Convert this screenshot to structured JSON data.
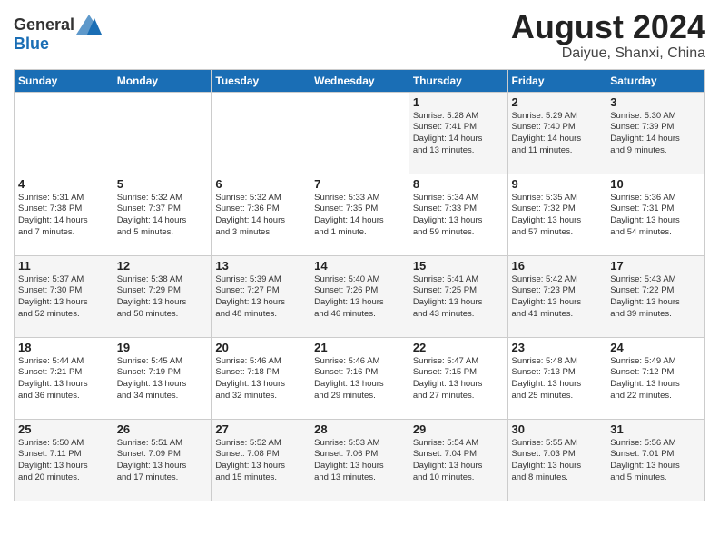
{
  "header": {
    "logo_general": "General",
    "logo_blue": "Blue",
    "month_year": "August 2024",
    "location": "Daiyue, Shanxi, China"
  },
  "weekdays": [
    "Sunday",
    "Monday",
    "Tuesday",
    "Wednesday",
    "Thursday",
    "Friday",
    "Saturday"
  ],
  "weeks": [
    [
      {
        "day": "",
        "info": ""
      },
      {
        "day": "",
        "info": ""
      },
      {
        "day": "",
        "info": ""
      },
      {
        "day": "",
        "info": ""
      },
      {
        "day": "1",
        "info": "Sunrise: 5:28 AM\nSunset: 7:41 PM\nDaylight: 14 hours\nand 13 minutes."
      },
      {
        "day": "2",
        "info": "Sunrise: 5:29 AM\nSunset: 7:40 PM\nDaylight: 14 hours\nand 11 minutes."
      },
      {
        "day": "3",
        "info": "Sunrise: 5:30 AM\nSunset: 7:39 PM\nDaylight: 14 hours\nand 9 minutes."
      }
    ],
    [
      {
        "day": "4",
        "info": "Sunrise: 5:31 AM\nSunset: 7:38 PM\nDaylight: 14 hours\nand 7 minutes."
      },
      {
        "day": "5",
        "info": "Sunrise: 5:32 AM\nSunset: 7:37 PM\nDaylight: 14 hours\nand 5 minutes."
      },
      {
        "day": "6",
        "info": "Sunrise: 5:32 AM\nSunset: 7:36 PM\nDaylight: 14 hours\nand 3 minutes."
      },
      {
        "day": "7",
        "info": "Sunrise: 5:33 AM\nSunset: 7:35 PM\nDaylight: 14 hours\nand 1 minute."
      },
      {
        "day": "8",
        "info": "Sunrise: 5:34 AM\nSunset: 7:33 PM\nDaylight: 13 hours\nand 59 minutes."
      },
      {
        "day": "9",
        "info": "Sunrise: 5:35 AM\nSunset: 7:32 PM\nDaylight: 13 hours\nand 57 minutes."
      },
      {
        "day": "10",
        "info": "Sunrise: 5:36 AM\nSunset: 7:31 PM\nDaylight: 13 hours\nand 54 minutes."
      }
    ],
    [
      {
        "day": "11",
        "info": "Sunrise: 5:37 AM\nSunset: 7:30 PM\nDaylight: 13 hours\nand 52 minutes."
      },
      {
        "day": "12",
        "info": "Sunrise: 5:38 AM\nSunset: 7:29 PM\nDaylight: 13 hours\nand 50 minutes."
      },
      {
        "day": "13",
        "info": "Sunrise: 5:39 AM\nSunset: 7:27 PM\nDaylight: 13 hours\nand 48 minutes."
      },
      {
        "day": "14",
        "info": "Sunrise: 5:40 AM\nSunset: 7:26 PM\nDaylight: 13 hours\nand 46 minutes."
      },
      {
        "day": "15",
        "info": "Sunrise: 5:41 AM\nSunset: 7:25 PM\nDaylight: 13 hours\nand 43 minutes."
      },
      {
        "day": "16",
        "info": "Sunrise: 5:42 AM\nSunset: 7:23 PM\nDaylight: 13 hours\nand 41 minutes."
      },
      {
        "day": "17",
        "info": "Sunrise: 5:43 AM\nSunset: 7:22 PM\nDaylight: 13 hours\nand 39 minutes."
      }
    ],
    [
      {
        "day": "18",
        "info": "Sunrise: 5:44 AM\nSunset: 7:21 PM\nDaylight: 13 hours\nand 36 minutes."
      },
      {
        "day": "19",
        "info": "Sunrise: 5:45 AM\nSunset: 7:19 PM\nDaylight: 13 hours\nand 34 minutes."
      },
      {
        "day": "20",
        "info": "Sunrise: 5:46 AM\nSunset: 7:18 PM\nDaylight: 13 hours\nand 32 minutes."
      },
      {
        "day": "21",
        "info": "Sunrise: 5:46 AM\nSunset: 7:16 PM\nDaylight: 13 hours\nand 29 minutes."
      },
      {
        "day": "22",
        "info": "Sunrise: 5:47 AM\nSunset: 7:15 PM\nDaylight: 13 hours\nand 27 minutes."
      },
      {
        "day": "23",
        "info": "Sunrise: 5:48 AM\nSunset: 7:13 PM\nDaylight: 13 hours\nand 25 minutes."
      },
      {
        "day": "24",
        "info": "Sunrise: 5:49 AM\nSunset: 7:12 PM\nDaylight: 13 hours\nand 22 minutes."
      }
    ],
    [
      {
        "day": "25",
        "info": "Sunrise: 5:50 AM\nSunset: 7:11 PM\nDaylight: 13 hours\nand 20 minutes."
      },
      {
        "day": "26",
        "info": "Sunrise: 5:51 AM\nSunset: 7:09 PM\nDaylight: 13 hours\nand 17 minutes."
      },
      {
        "day": "27",
        "info": "Sunrise: 5:52 AM\nSunset: 7:08 PM\nDaylight: 13 hours\nand 15 minutes."
      },
      {
        "day": "28",
        "info": "Sunrise: 5:53 AM\nSunset: 7:06 PM\nDaylight: 13 hours\nand 13 minutes."
      },
      {
        "day": "29",
        "info": "Sunrise: 5:54 AM\nSunset: 7:04 PM\nDaylight: 13 hours\nand 10 minutes."
      },
      {
        "day": "30",
        "info": "Sunrise: 5:55 AM\nSunset: 7:03 PM\nDaylight: 13 hours\nand 8 minutes."
      },
      {
        "day": "31",
        "info": "Sunrise: 5:56 AM\nSunset: 7:01 PM\nDaylight: 13 hours\nand 5 minutes."
      }
    ]
  ]
}
